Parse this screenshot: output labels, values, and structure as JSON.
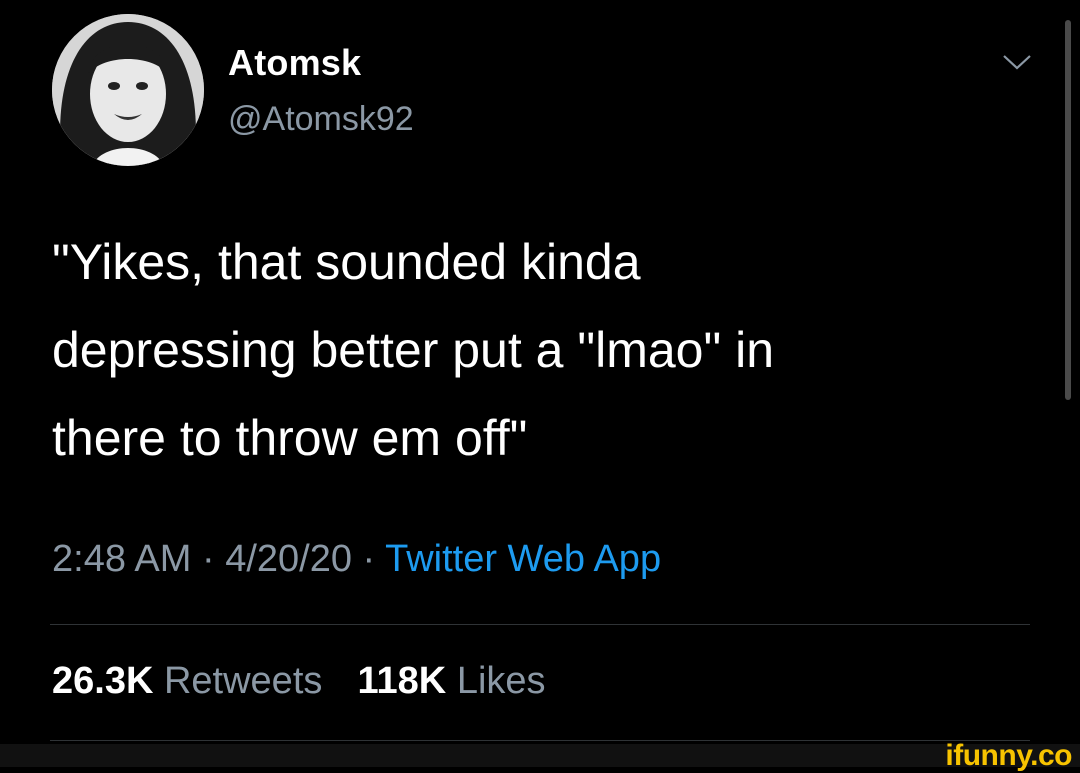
{
  "author": {
    "display_name": "Atomsk",
    "handle": "@Atomsk92",
    "avatar_icon": "profile-photo"
  },
  "tweet": {
    "lines": [
      "\"Yikes, that sounded kinda",
      "depressing better put a \"lmao\" in",
      "there to throw em off\""
    ],
    "time": "2:48 AM",
    "separator": " · ",
    "date": "4/20/20",
    "source": "Twitter Web App"
  },
  "stats": {
    "retweets_count": "26.3K",
    "retweets_label": "Retweets",
    "likes_count": "118K",
    "likes_label": "Likes"
  },
  "watermark": "ifunny.co",
  "colors": {
    "background": "#000000",
    "text": "#ffffff",
    "secondary": "#8b98a5",
    "link": "#1d9bf0",
    "watermark": "#f7c300"
  }
}
